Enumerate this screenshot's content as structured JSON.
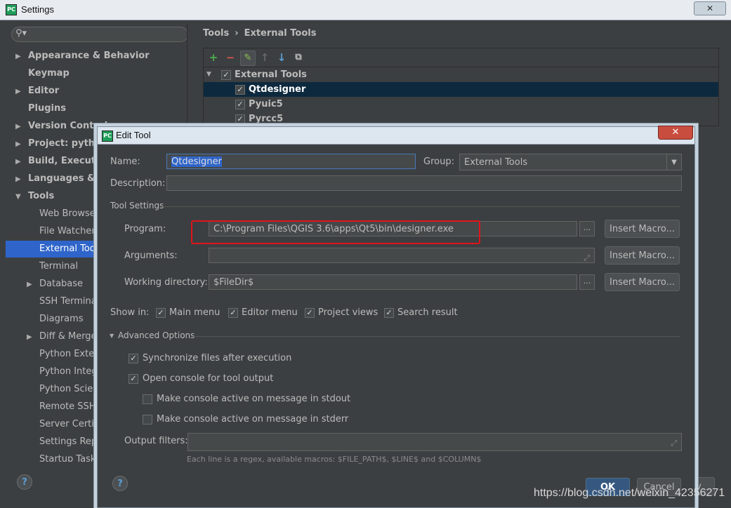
{
  "window": {
    "title": "Settings",
    "icon": "pycharm-icon",
    "close_label": "✕"
  },
  "sidebar": {
    "search_placeholder": "",
    "items": [
      {
        "label": "Appearance & Behavior",
        "expandable": true
      },
      {
        "label": "Keymap",
        "expandable": false
      },
      {
        "label": "Editor",
        "expandable": true
      },
      {
        "label": "Plugins",
        "expandable": false
      },
      {
        "label": "Version Control",
        "expandable": true
      },
      {
        "label": "Project: python",
        "expandable": true
      },
      {
        "label": "Build, Execution",
        "expandable": true
      },
      {
        "label": "Languages & Fr",
        "expandable": true
      },
      {
        "label": "Tools",
        "expandable": true,
        "expanded": true
      },
      {
        "label": "Web Browsers"
      },
      {
        "label": "File Watchers"
      },
      {
        "label": "External Tools",
        "selected": true
      },
      {
        "label": "Terminal"
      },
      {
        "label": "Database",
        "expandable": true
      },
      {
        "label": "SSH Terminal"
      },
      {
        "label": "Diagrams"
      },
      {
        "label": "Diff & Merge",
        "expandable": true
      },
      {
        "label": "Python Extern"
      },
      {
        "label": "Python Integra"
      },
      {
        "label": "Python Scienti"
      },
      {
        "label": "Remote SSH E"
      },
      {
        "label": "Server Certific"
      },
      {
        "label": "Settings Repo"
      },
      {
        "label": "Startup Tasks"
      }
    ]
  },
  "breadcrumb": {
    "parent": "Tools",
    "separator": "›",
    "current": "External Tools"
  },
  "tools_panel": {
    "toolbar": {
      "add": "+",
      "remove": "−",
      "edit": "✎",
      "up": "↑",
      "down": "↓",
      "copy": "⧉"
    },
    "group": "External Tools",
    "tools": [
      "Qtdesigner",
      "Pyuic5",
      "Pyrcc5"
    ]
  },
  "dialog": {
    "title": "Edit Tool",
    "close_label": "✕",
    "name_label": "Name:",
    "name_value": "Qtdesigner",
    "group_label": "Group:",
    "group_value": "External Tools",
    "description_label": "Description:",
    "description_value": "",
    "tool_settings_label": "Tool Settings",
    "program_label": "Program:",
    "program_value": "C:\\Program Files\\QGIS 3.6\\apps\\Qt5\\bin\\designer.exe",
    "arguments_label": "Arguments:",
    "arguments_value": "",
    "working_dir_label": "Working directory:",
    "working_dir_value": "$FileDir$",
    "insert_macro_label": "Insert Macro...",
    "dots_label": "...",
    "show_in_label": "Show in:",
    "show_in": [
      {
        "label": "Main menu",
        "checked": true
      },
      {
        "label": "Editor menu",
        "checked": true
      },
      {
        "label": "Project views",
        "checked": true
      },
      {
        "label": "Search result",
        "checked": true
      }
    ],
    "advanced_label": "Advanced Options",
    "sync_label": "Synchronize files after execution",
    "open_console_label": "Open console for tool output",
    "stdout_label": "Make console active on message in stdout",
    "stderr_label": "Make console active on message in stderr",
    "output_filters_label": "Output filters:",
    "output_filters_value": "",
    "hint": "Each line is a regex, available macros: $FILE_PATH$, $LINE$ and $COLUMN$",
    "ok_label": "OK",
    "cancel_label": "Cancel",
    "help_label": "?"
  },
  "background_buttons": {
    "apply_partial": "ply",
    "help_label": "?"
  },
  "watermark": "https://blog.csdn.net/weixin_42356271",
  "colors": {
    "accent": "#2f65ca",
    "highlight_box": "#e0141b",
    "background": "#3c3f41",
    "tree_selected": "#0d293e"
  }
}
